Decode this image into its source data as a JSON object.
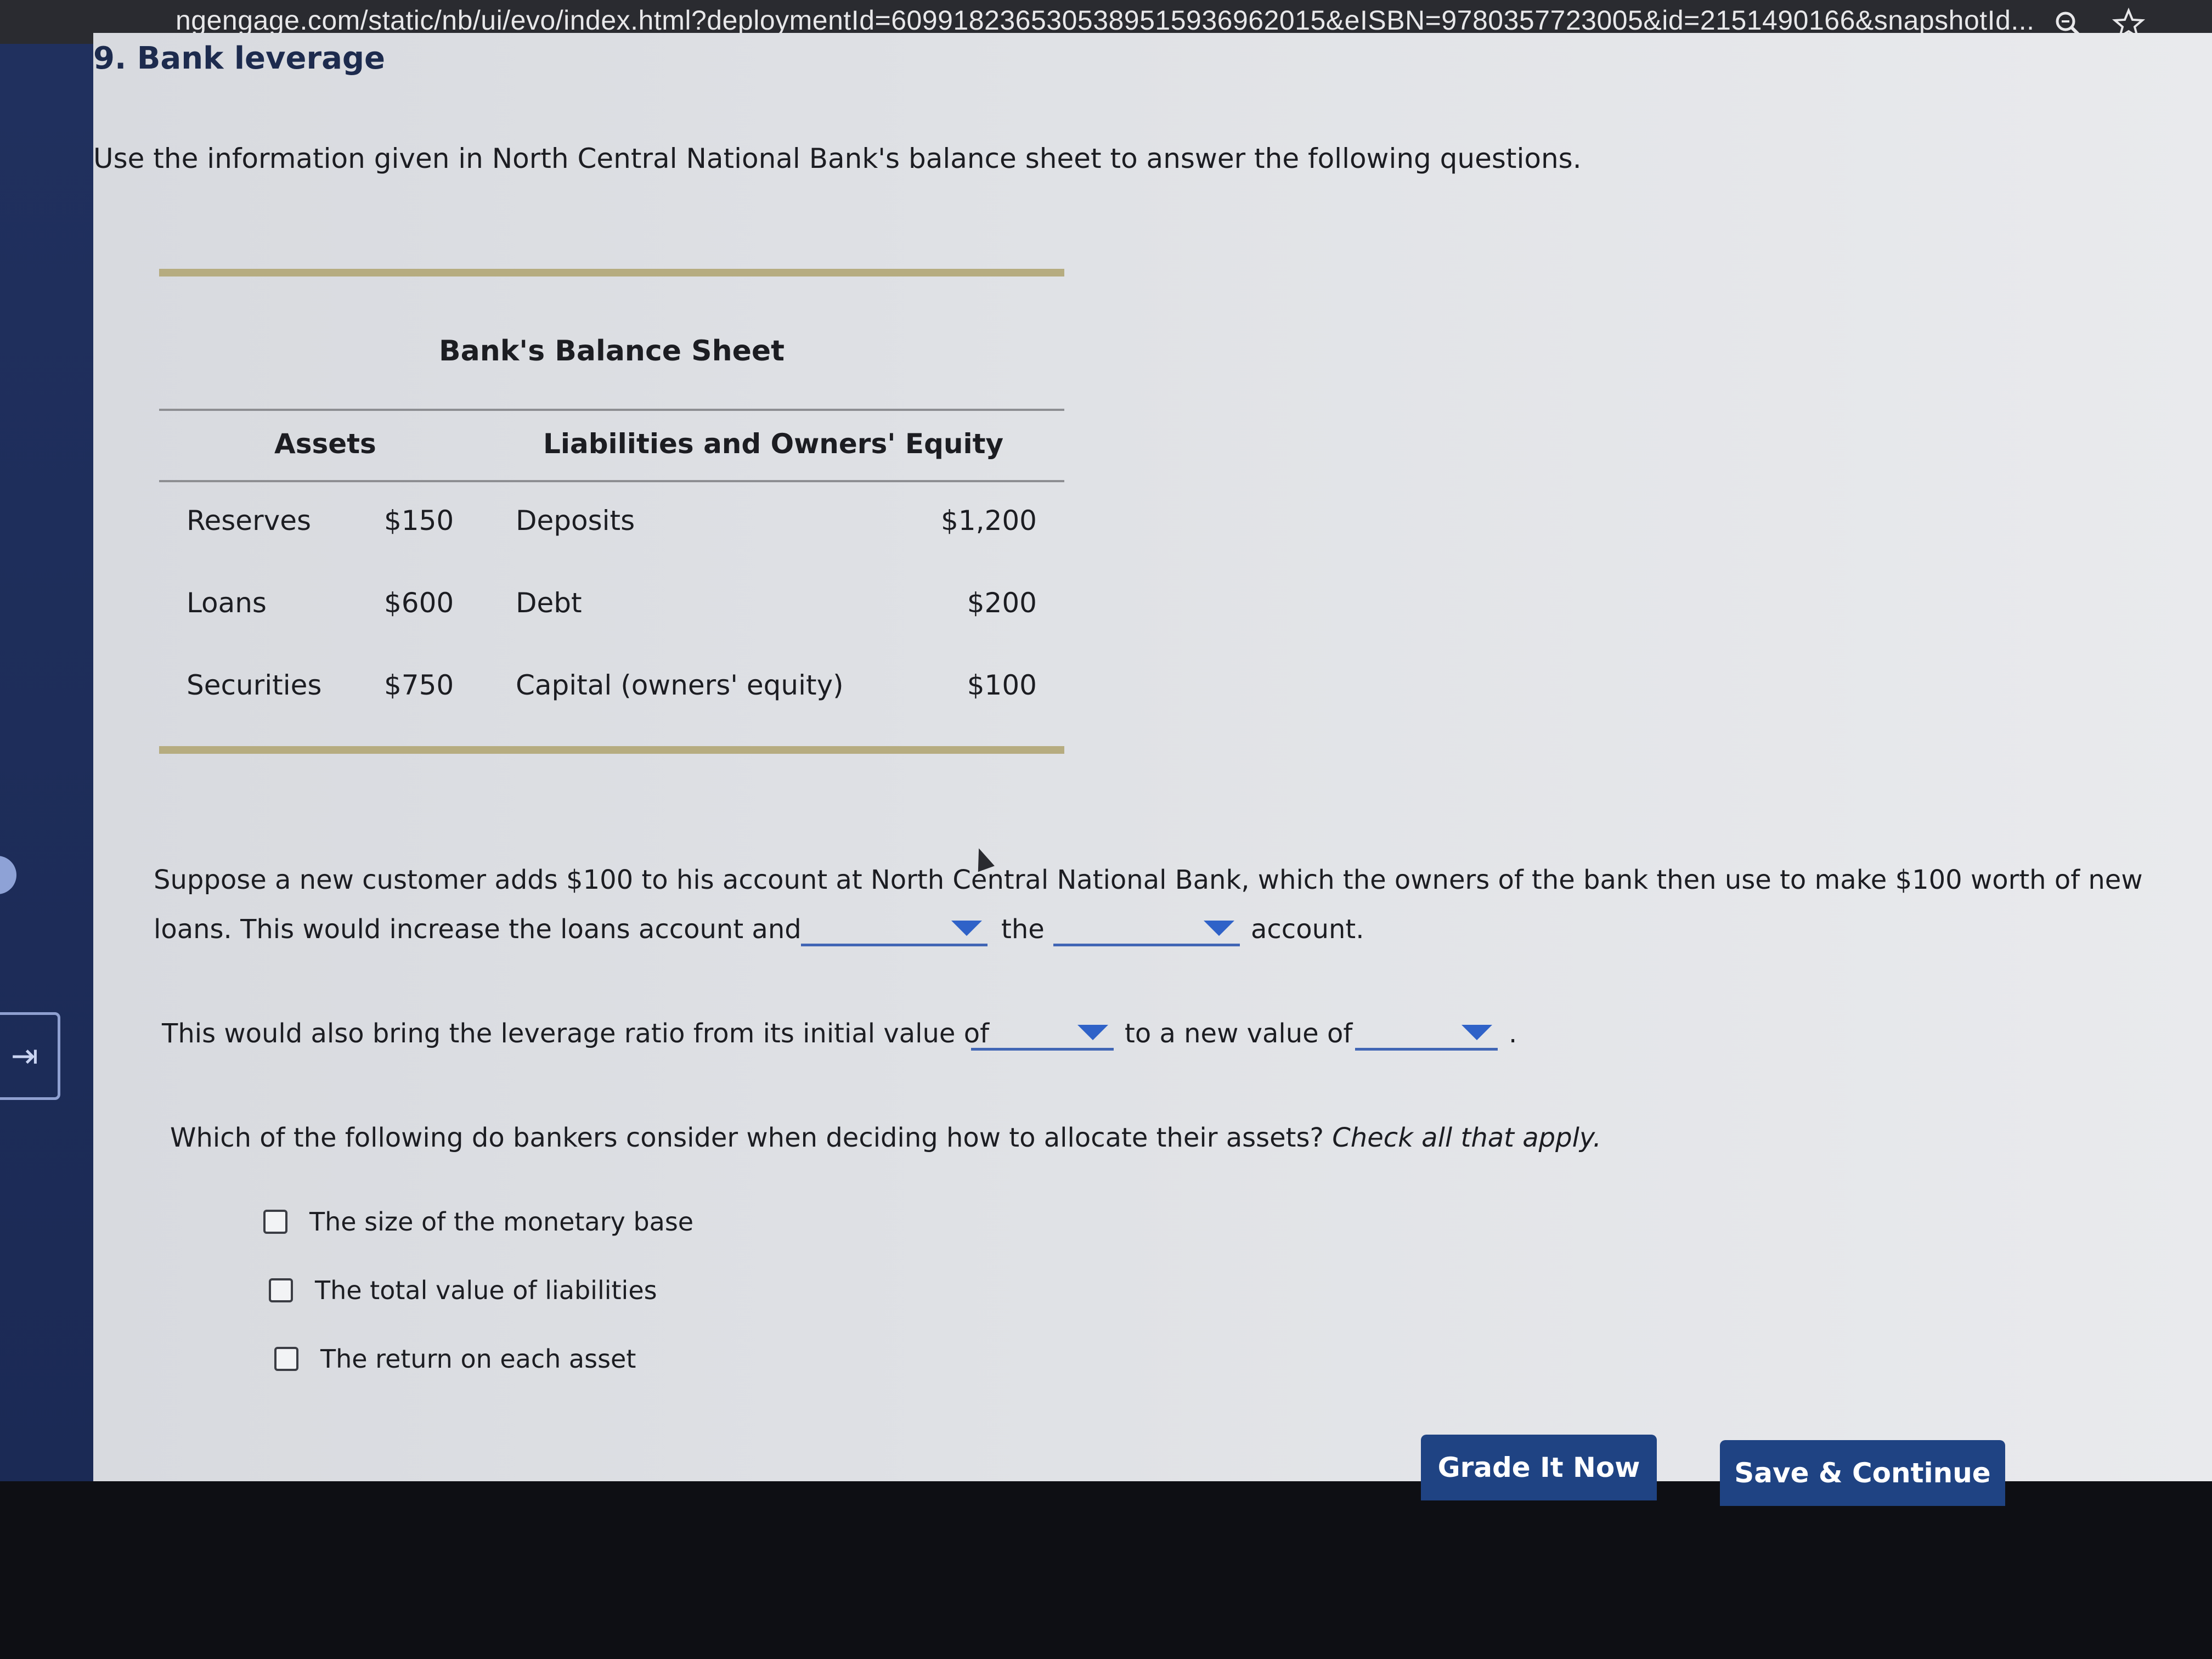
{
  "browser": {
    "url": "ngengage.com/static/nb/ui/evo/index.html?deploymentId=6099182365305389515936962015&eISBN=9780357723005&id=2151490166&snapshotId..."
  },
  "question": {
    "title": "9. Bank leverage",
    "intro": "Use the information given in North Central National Bank's balance sheet to answer the following questions."
  },
  "balance_sheet": {
    "title": "Bank's Balance Sheet",
    "assets_header": "Assets",
    "liabilities_header": "Liabilities and Owners' Equity",
    "rows": [
      {
        "asset": "Reserves",
        "asset_value": "$150",
        "liability": "Deposits",
        "liability_value": "$1,200"
      },
      {
        "asset": "Loans",
        "asset_value": "$600",
        "liability": "Debt",
        "liability_value": "$200"
      },
      {
        "asset": "Securities",
        "asset_value": "$750",
        "liability": "Capital (owners' equity)",
        "liability_value": "$100"
      }
    ]
  },
  "part1": {
    "line1": "Suppose a new customer adds $100 to his account at North Central National Bank, which the owners of the bank then use to make $100 worth of new",
    "line2_start": "loans. This would increase the loans account and",
    "line2_mid": "the",
    "line2_end": "account."
  },
  "part2": {
    "start": "This would also bring the leverage ratio from its initial value of",
    "mid": "to a new value of",
    "end": "."
  },
  "part3": {
    "prompt": "Which of the following do bankers consider when deciding how to allocate their assets?",
    "prompt_italic": "Check all that apply.",
    "options": [
      "The size of the monetary base",
      "The total value of liabilities",
      "The return on each asset"
    ]
  },
  "buttons": {
    "grade": "Grade It Now",
    "save": "Save & Continue"
  },
  "colors": {
    "accent": "#1f4383",
    "dropdown": "#2f62c8",
    "rule": "#b6ac80"
  }
}
